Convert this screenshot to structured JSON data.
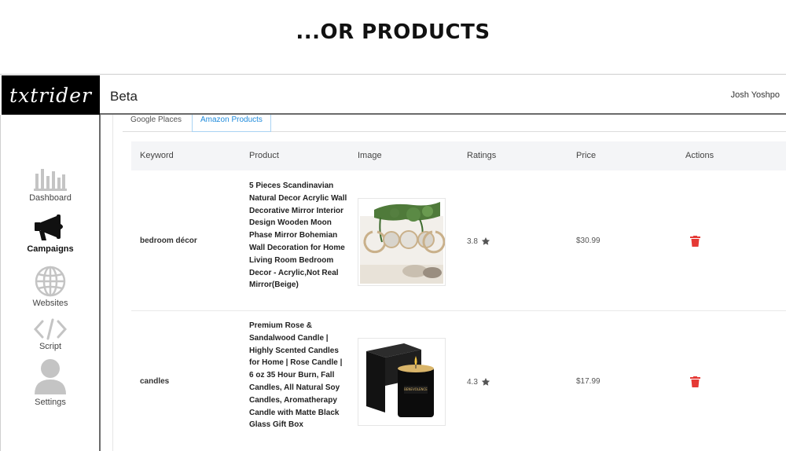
{
  "banner": {
    "title": "...OR PRODUCTS"
  },
  "app": {
    "logo": "txtrider",
    "title": "Beta",
    "user": "Josh Yoshpo"
  },
  "sidebar": {
    "items": [
      {
        "label": "Dashboard",
        "icon": "bar-chart-icon"
      },
      {
        "label": "Campaigns",
        "icon": "megaphone-icon",
        "active": true
      },
      {
        "label": "Websites",
        "icon": "globe-icon"
      },
      {
        "label": "Script",
        "icon": "code-icon"
      },
      {
        "label": "Settings",
        "icon": "user-icon"
      }
    ]
  },
  "tabs": [
    {
      "label": "Google Places"
    },
    {
      "label": "Amazon Products",
      "active": true
    }
  ],
  "table": {
    "headers": [
      "Keyword",
      "Product",
      "Image",
      "Ratings",
      "Price",
      "Actions"
    ],
    "rows": [
      {
        "keyword": "bedroom décor",
        "product": "5 Pieces Scandinavian Natural Decor Acrylic Wall Decorative Mirror Interior Design Wooden Moon Phase Mirror Bohemian Wall Decoration for Home Living Room Bedroom Decor - Acrylic,Not Real Mirror(Beige)",
        "image": "moon-phase-mirror-image",
        "rating": "3.8",
        "price": "$30.99"
      },
      {
        "keyword": "candles",
        "product": "Premium Rose & Sandalwood Candle | Highly Scented Candles for Home | Rose Candle | 6 oz 35 Hour Burn, Fall Candles, All Natural Soy Candles, Aromatherapy Candle with Matte Black Glass Gift Box",
        "image": "black-candle-image",
        "rating": "4.3",
        "price": "$17.99"
      }
    ]
  },
  "colors": {
    "accent": "#1f8bdc",
    "danger": "#e53935",
    "sidebar_border": "#6b6b6b"
  }
}
